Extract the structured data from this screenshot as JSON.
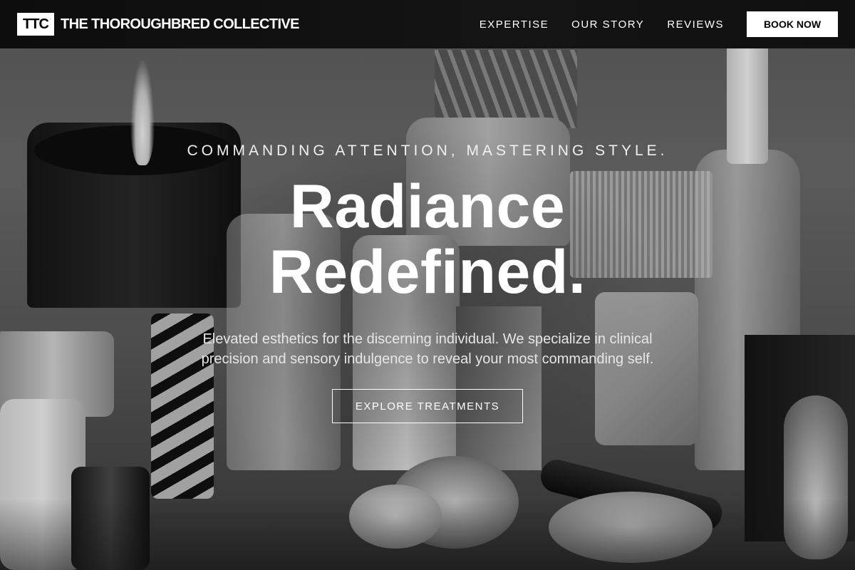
{
  "nav": {
    "logo_mark": "TTC",
    "brand_name": "THE THOROUGHBRED COLLECTIVE",
    "links": [
      "EXPERTISE",
      "OUR STORY",
      "REVIEWS"
    ],
    "book_label": "BOOK NOW"
  },
  "hero": {
    "eyebrow": "COMMANDING ATTENTION, MASTERING STYLE.",
    "headline_line1": "Radiance",
    "headline_line2": "Redefined.",
    "subtext": "Elevated esthetics for the discerning individual. We specialize in clinical precision and sensory indulgence to reveal your most commanding self.",
    "cta_label": "EXPLORE TREATMENTS"
  },
  "colors": {
    "nav_background": "#111111",
    "primary_button": "#ffffff",
    "text": "#ffffff"
  }
}
